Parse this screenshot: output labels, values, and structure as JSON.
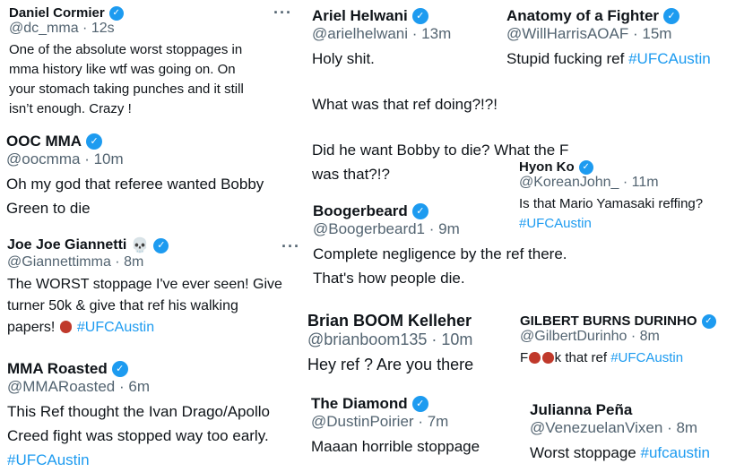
{
  "colors": {
    "link": "#1d9bf0",
    "muted": "#536471",
    "text": "#0f1419",
    "verified": "#1d9bf0"
  },
  "icons": {
    "verified": "verified-badge-icon",
    "more": "more-options-icon",
    "skull": "skull-emoji-icon",
    "angry": "angry-face-emoji-icon"
  },
  "tweets": [
    {
      "name": "Daniel Cormier",
      "handle": "@dc_mma",
      "time": "12s",
      "lines": [
        "One of the absolute worst stoppages in",
        "mma history like wtf was going on. On",
        "your stomach taking punches and it still",
        "isn’t enough. Crazy !"
      ],
      "more": "···"
    },
    {
      "name": "OOC MMA",
      "handle": "@oocmma",
      "time": "10m",
      "lines": [
        "Oh my god that referee wanted Bobby",
        "Green to die"
      ]
    },
    {
      "name": "Joe Joe Giannetti",
      "skull": "💀",
      "handle": "@Giannettimma",
      "time": "8m",
      "lines": [
        "The WORST stoppage I've ever seen! Give",
        "turner 50k & give that ref his walking",
        "papers!"
      ],
      "hashtag": "#UFCAustin",
      "more": "···"
    },
    {
      "name": "MMA Roasted",
      "handle": "@MMARoasted",
      "time": "6m",
      "lines": [
        "This Ref thought the Ivan Drago/Apollo",
        "Creed fight was stopped way too early."
      ],
      "hashtag": "#UFCAustin"
    },
    {
      "name": "Ariel Helwani",
      "handle": "@arielhelwani",
      "time": "13m",
      "p1": "Holy shit.",
      "p2": "What was that ref doing?!?!",
      "p3": [
        "Did he want Bobby to die? What the F",
        "was that?!?"
      ]
    },
    {
      "name": "Boogerbeard",
      "handle": "@Boogerbeard1",
      "time": "9m",
      "lines": [
        "Complete negligence by the ref there.",
        "That's how people die."
      ]
    },
    {
      "name": "Brian BOOM Kelleher",
      "handle": "@brianboom135",
      "time": "10m",
      "lines": [
        "Hey ref ? Are you there"
      ]
    },
    {
      "name": "The Diamond",
      "handle": "@DustinPoirier",
      "time": "7m",
      "lines": [
        "Maaan horrible stoppage"
      ]
    },
    {
      "name": "Anatomy of a Fighter",
      "handle": "@WillHarrisAOAF",
      "time": "15m",
      "text": "Stupid fucking ref",
      "hashtag": "#UFCAustin"
    },
    {
      "name": "Hyon Ko",
      "handle": "@KoreanJohn_",
      "time": "11m",
      "text": "Is that Mario Yamasaki reffing?",
      "hashtag": "#UFCAustin"
    },
    {
      "name": "GILBERT BURNS DURINHO",
      "handle": "@GilbertDurinho",
      "time": "8m",
      "pre": "F",
      "post": "k that ref",
      "hashtag": "#UFCAustin"
    },
    {
      "name": "Julianna Peña",
      "handle": "@VenezuelanVixen",
      "time": "8m",
      "text": "Worst stoppage",
      "hashtag": "#ufcaustin"
    }
  ]
}
